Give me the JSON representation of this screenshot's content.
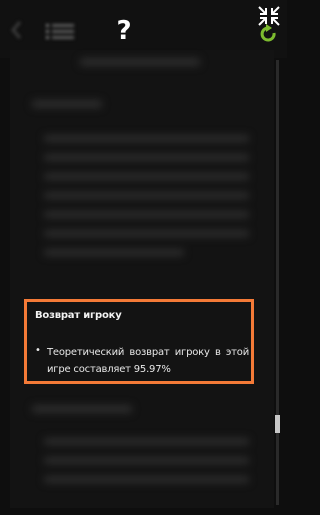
{
  "toolbar": {
    "help_label": "?",
    "icons": {
      "back": "back-arrow-icon",
      "menu": "menu-list-icon",
      "collapse": "collapse-arrows-icon",
      "refresh": "refresh-icon"
    }
  },
  "rtp_section": {
    "title": "Возврат игроку",
    "bullet": "•",
    "text": "Теоретический возврат игроку в этой игре составляет 95.97%"
  },
  "colors": {
    "highlight_border": "#f47a37",
    "refresh_icon": "#7dbb2f",
    "background": "#0e0e0e"
  }
}
